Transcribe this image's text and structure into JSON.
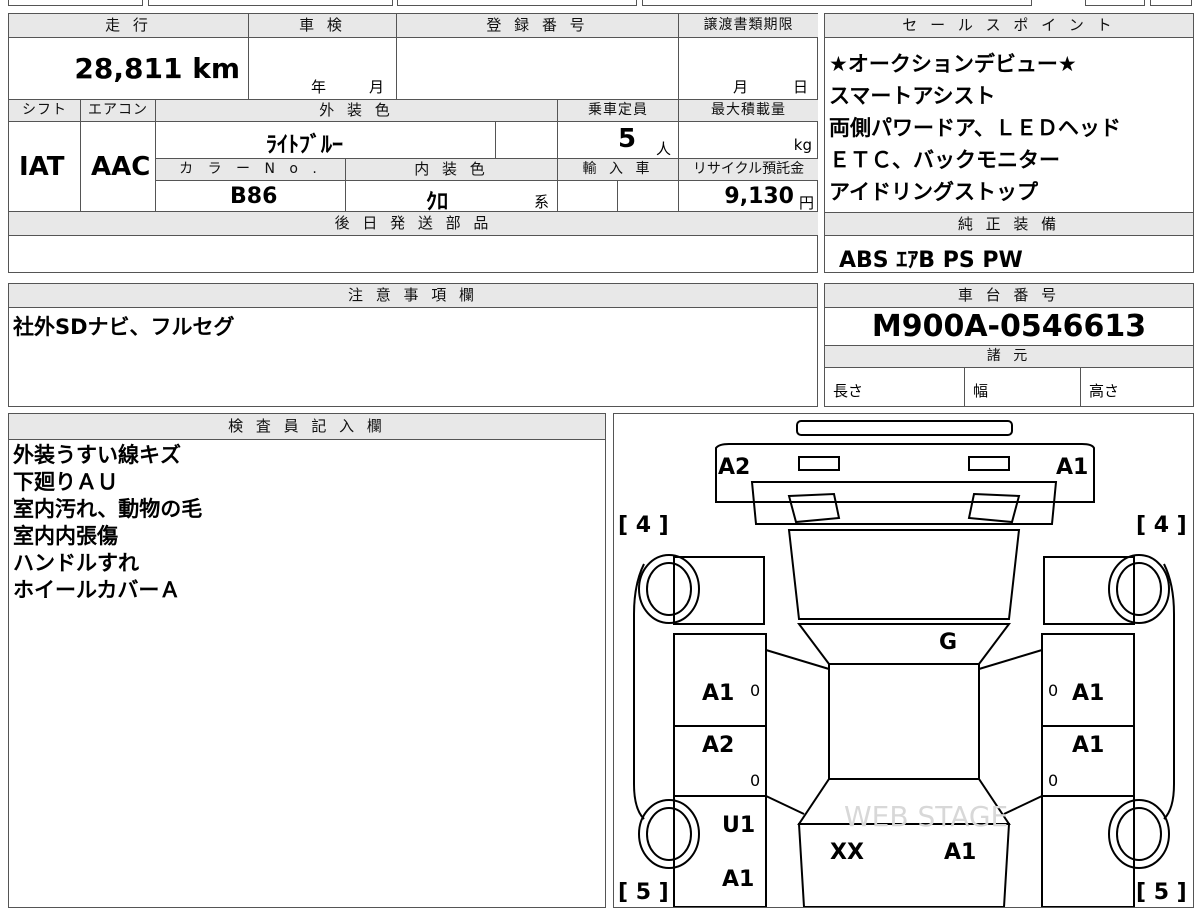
{
  "top_strip_text": "",
  "headers": {
    "mileage": "走 行",
    "inspection": "車 検",
    "registration": "登 録 番 号",
    "transfer_deadline": "譲渡書類期限",
    "shift": "シフト",
    "aircon": "エアコン",
    "exterior_color": "外 装 色",
    "capacity": "乗車定員",
    "max_load": "最大積載量",
    "color_no": "カ ラ ー N o .",
    "interior_color": "内 装 色",
    "import": "輸 入 車",
    "recycle": "リサイクル預託金",
    "later_parts": "後 日 発 送 部 品",
    "sales_points": "セ ー ル ス ポ イ ン ト",
    "genuine_equipment": "純 正 装 備",
    "notes": "注 意 事 項 欄",
    "chassis_no": "車 台 番 号",
    "specs": "諸 元",
    "inspector": "検 査 員 記 入 欄"
  },
  "values": {
    "mileage": "28,811 km",
    "year_unit": "年",
    "month_unit": "月",
    "deadline_month": "月",
    "deadline_day": "日",
    "shift": "IAT",
    "aircon": "AAC",
    "exterior_color": "ﾗｲﾄﾌﾞﾙｰ",
    "capacity": "5",
    "capacity_unit": "人",
    "max_load_unit": "kg",
    "color_no": "B86",
    "interior_color": "ｸﾛ",
    "interior_suffix": "系",
    "recycle_amount": "9,130",
    "recycle_unit": "円",
    "chassis_no": "M900A-0546613",
    "length_label": "長さ",
    "width_label": "幅",
    "height_label": "高さ"
  },
  "sales_points": [
    "★オークションデビュー★",
    "スマートアシスト",
    "両側パワードア、ＬＥＤヘッド",
    "ＥＴＣ、バックモニター",
    "アイドリングストップ"
  ],
  "genuine_equipment": "ABS ｴｱB PS PW",
  "notes_text": "社外SDナビ、フルセグ",
  "inspector_notes": [
    "外装うすい線キズ",
    "下廻りＡＵ",
    "室内汚れ、動物の毛",
    "室内内張傷",
    "ハンドルすれ",
    "ホイールカバーＡ"
  ],
  "diagram": {
    "tire_fl": "[ 4 ]",
    "tire_fr": "[ 4 ]",
    "tire_rl": "[ 5 ]",
    "tire_rr": "[ 5 ]",
    "marks": {
      "front_bumper_left": "A2",
      "front_bumper_right": "A1",
      "windshield": "G",
      "front_door_left": "A1",
      "front_door_right": "A1",
      "rear_door_left": "A2",
      "rear_door_right": "A1",
      "rear_quarter_left": "U1",
      "rear_bumper_left": "A1",
      "tailgate_left": "XX",
      "tailgate_right": "A1",
      "zero": "0"
    },
    "watermark": "WEB STAGE"
  }
}
